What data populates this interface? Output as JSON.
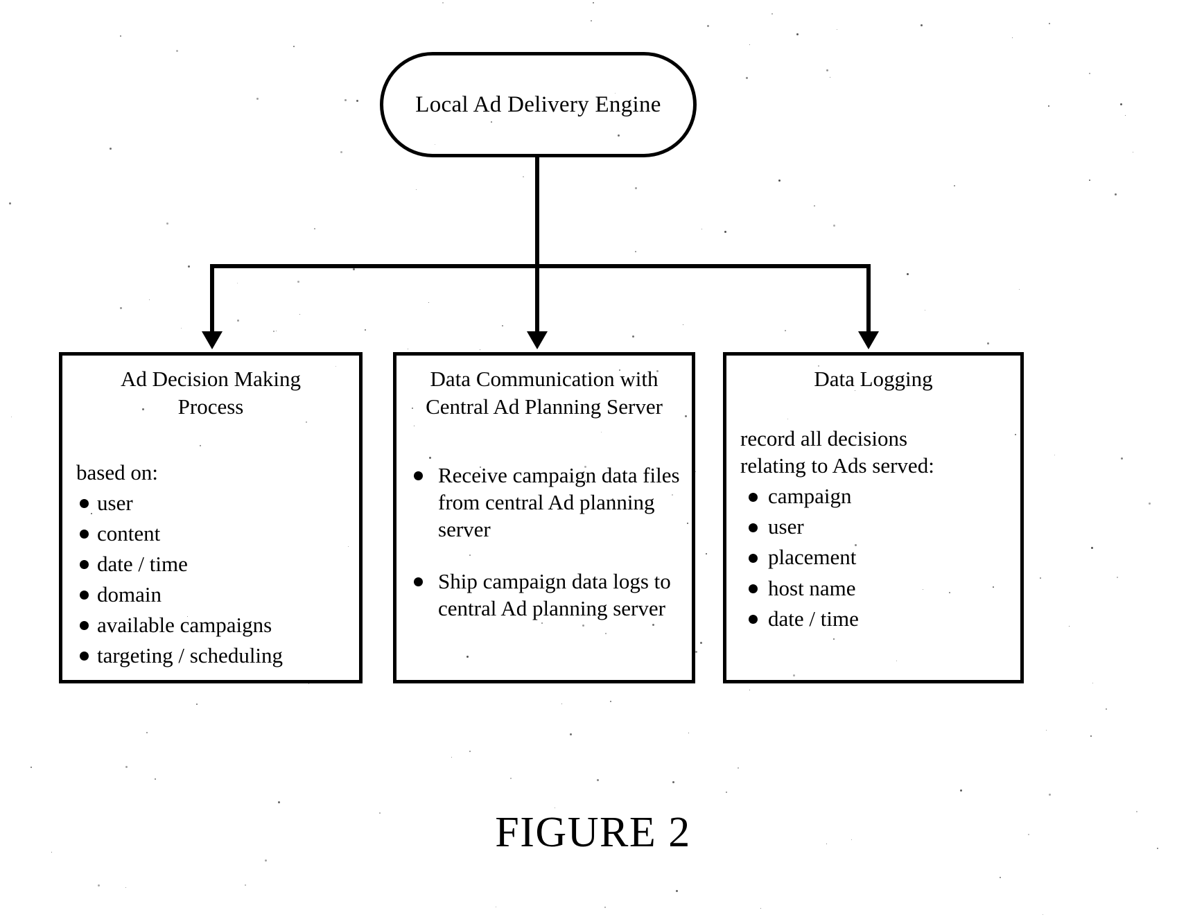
{
  "figure": {
    "caption": "FIGURE 2"
  },
  "root": {
    "label": "Local Ad Delivery Engine",
    "shape": "rounded-rectangle"
  },
  "boxes": [
    {
      "id": "ad-decision-making-process",
      "title": "Ad Decision Making\nProcess",
      "title_line1": "Ad Decision Making",
      "title_line2": "Process",
      "intro": "based on:",
      "bullets": [
        "user",
        "content",
        "date / time",
        "domain",
        "available campaigns",
        "targeting / scheduling"
      ]
    },
    {
      "id": "data-communication-with-central-ad-planning-server",
      "title": "Data Communication with\nCentral Ad Planning Server",
      "title_line1": "Data Communication with",
      "title_line2": "Central Ad Planning Server",
      "intro": "",
      "bullets": [
        "Receive campaign data files from central Ad planning server",
        "Ship campaign data logs to central Ad planning server"
      ]
    },
    {
      "id": "data-logging",
      "title": "Data Logging",
      "title_line1": "Data Logging",
      "title_line2": "",
      "intro": "record all decisions\nrelating to Ads served:",
      "intro_line1": "record all decisions",
      "intro_line2": "relating to Ads served:",
      "bullets": [
        "campaign",
        "user",
        "placement",
        "host name",
        "date / time"
      ]
    }
  ],
  "connectors": {
    "stem_from_root": "vertical line from Local Ad Delivery Engine down to distribution bus",
    "bus": "horizontal distribution bus",
    "branches": 3,
    "arrow_style": "solid filled triangle"
  },
  "colors": {
    "ink": "#000000",
    "paper": "#ffffff"
  }
}
